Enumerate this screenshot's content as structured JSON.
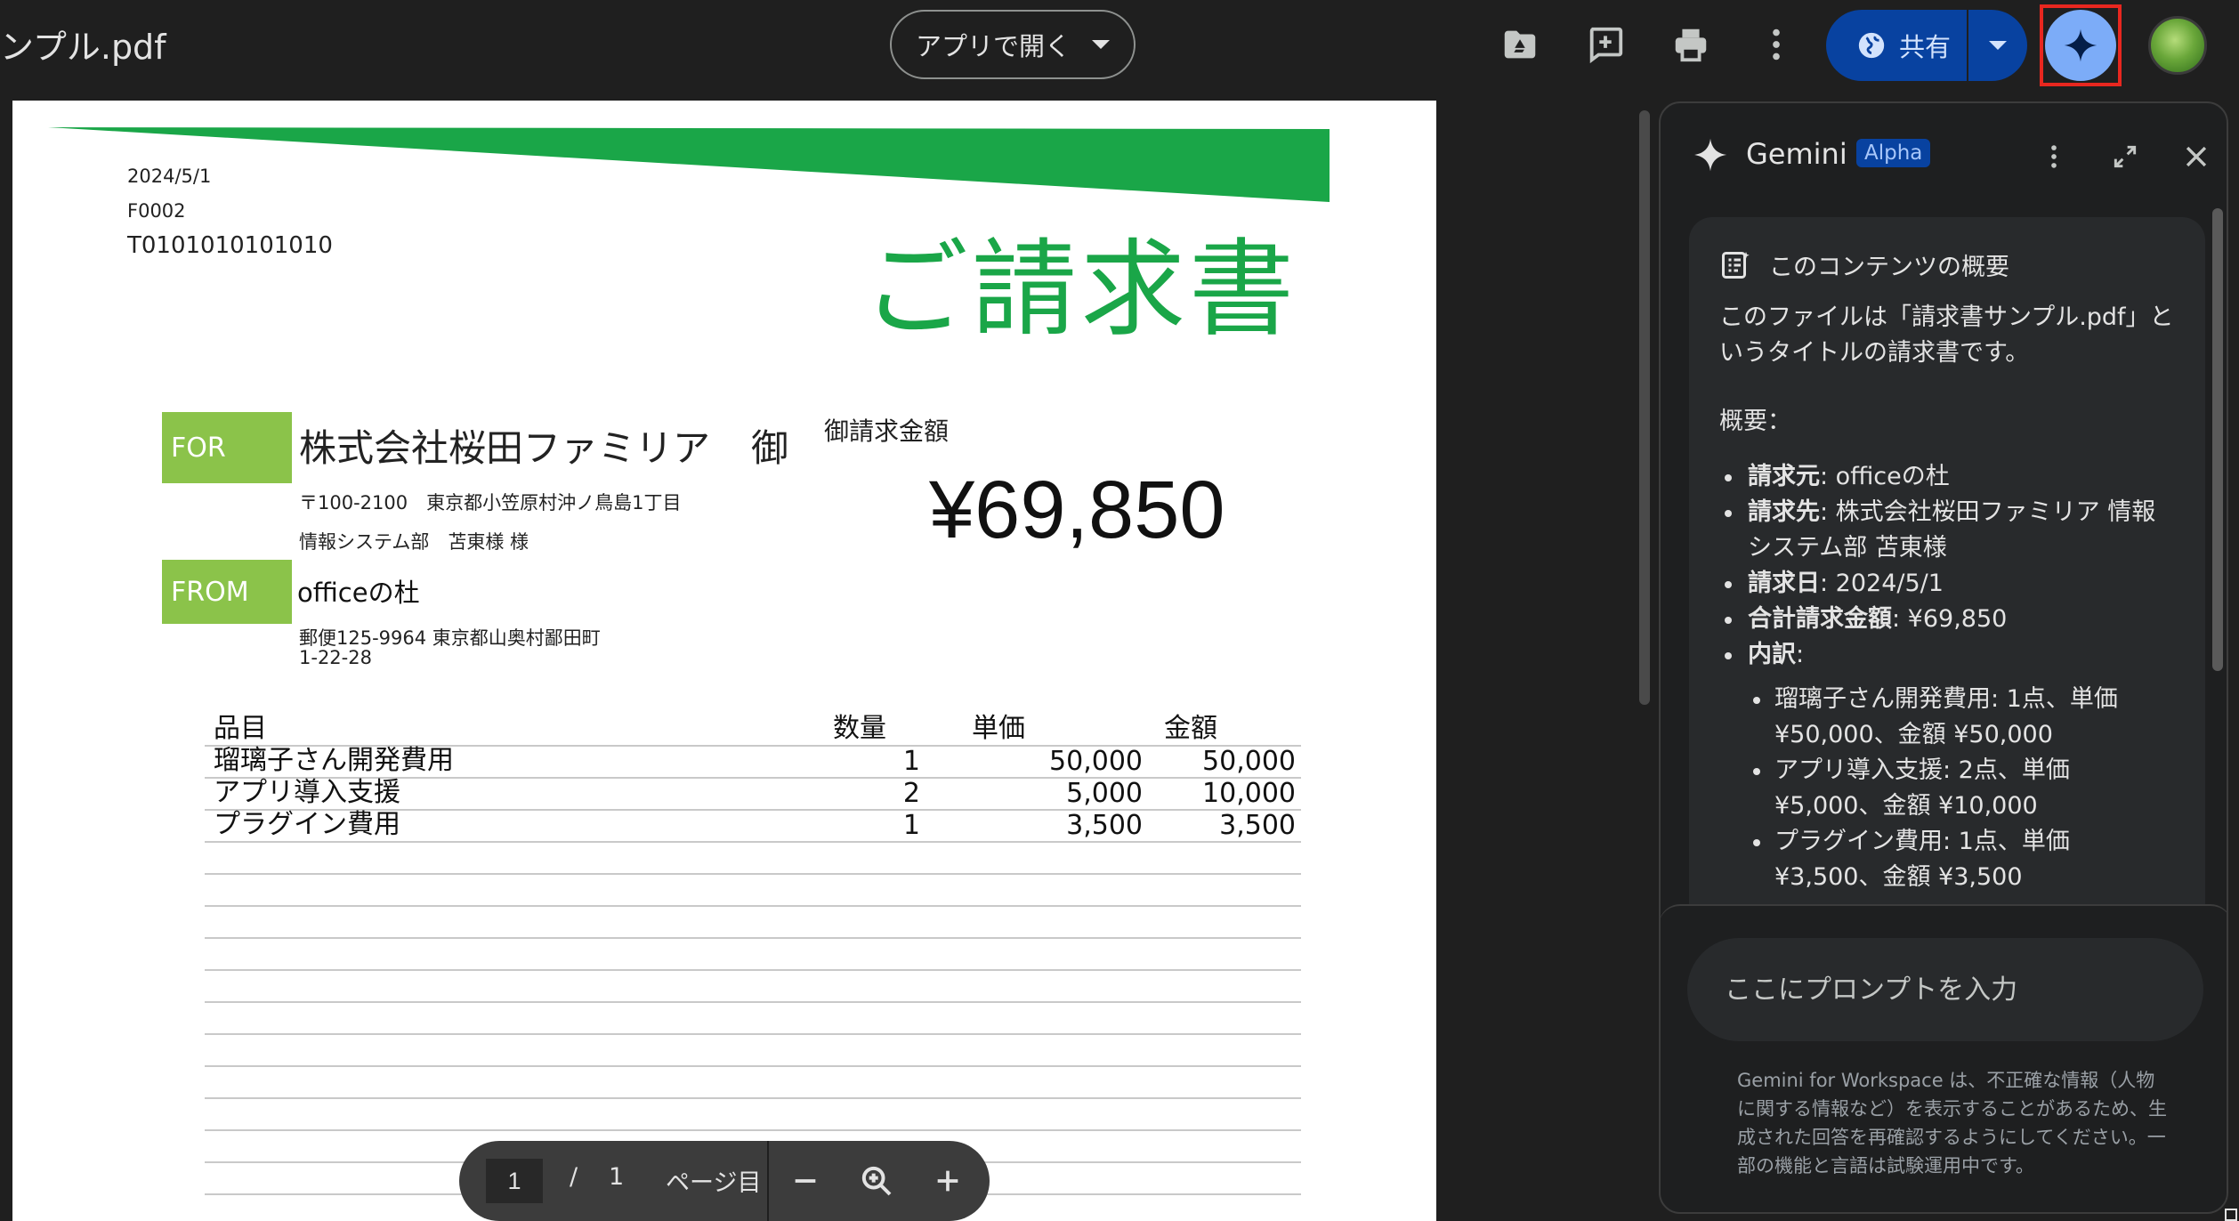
{
  "topbar": {
    "doc_title": "ンプル.pdf",
    "open_with_label": "アプリで開く",
    "share_label": "共有",
    "icons": [
      "add-to-drive-icon",
      "add-comment-icon",
      "print-icon",
      "more-vert-icon",
      "globe-icon",
      "gemini-icon",
      "avatar"
    ]
  },
  "pdf": {
    "date": "2024/5/1",
    "invoice_no": "F0002",
    "reg_no": "T0101010101010",
    "title": "ご請求書",
    "for_label": "FOR",
    "client_name": "株式会社桜田ファミリア",
    "client_honorific": "御",
    "client_address": "〒100-2100　東京都小笠原村沖ノ鳥島1丁目",
    "client_contact": "情報システム部　苫東様 様",
    "from_label": "FROM",
    "from_name": "officeの杜",
    "from_address_1": "郵便125-9964 東京都山奥村鄙田町",
    "from_address_2": "1-22-28",
    "amount_label": "御請求金額",
    "amount": "¥69,850",
    "columns": {
      "item": "品目",
      "qty": "数量",
      "unit_price": "単価",
      "total": "金額"
    },
    "rows": [
      {
        "item": "瑠璃子さん開発費用",
        "qty": "1",
        "unit_price": "50,000",
        "total": "50,000"
      },
      {
        "item": "アプリ導入支援",
        "qty": "2",
        "unit_price": "5,000",
        "total": "10,000"
      },
      {
        "item": "プラグイン費用",
        "qty": "1",
        "unit_price": "3,500",
        "total": "3,500"
      }
    ]
  },
  "pagebar": {
    "current": "1",
    "slash": "/",
    "total": "1",
    "suffix": "ページ目"
  },
  "gemini": {
    "name": "Gemini",
    "badge": "Alpha",
    "summary_title": "このコンテンツの概要",
    "intro": "このファイルは「請求書サンプル.pdf」というタイトルの請求書です。",
    "overview_label": "概要：",
    "bullets": [
      {
        "key": "請求元",
        "value": ": officeの杜"
      },
      {
        "key": "請求先",
        "value": ": 株式会社桜田ファミリア 情報システム部 苫東様"
      },
      {
        "key": "請求日",
        "value": ": 2024/5/1"
      },
      {
        "key": "合計請求金額",
        "value": ": ¥69,850"
      },
      {
        "key": "内訳",
        "value": ":"
      }
    ],
    "breakdown": [
      "瑠璃子さん開発費用: 1点、単価 ¥50,000、金額 ¥50,000",
      "アプリ導入支援: 2点、単価 ¥5,000、金額 ¥10,000",
      "プラグイン費用: 1点、単価 ¥3,500、金額 ¥3,500"
    ],
    "prompt_placeholder": "ここにプロンプトを入力",
    "disclaimer": "Gemini for Workspace は、不正確な情報（人物に関する情報など）を表示することがあるため、生成された回答を再確認するようにしてください。一部の機能と言語は試験運用中です。"
  },
  "colors": {
    "accent_green": "#1aa648",
    "label_green": "#8bc34a",
    "share_blue": "#0842a0",
    "gemini_blue": "#7cacf8",
    "highlight_red": "#e8271f"
  }
}
